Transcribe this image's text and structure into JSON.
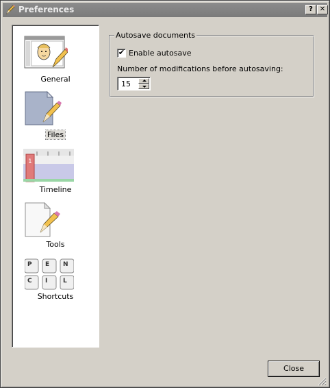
{
  "window": {
    "title": "Preferences",
    "help_button": "?",
    "close_button": "✕"
  },
  "sidebar": {
    "items": [
      {
        "label": "General",
        "icon": "general-icon"
      },
      {
        "label": "Files",
        "icon": "files-icon",
        "selected": true
      },
      {
        "label": "Timeline",
        "icon": "timeline-icon"
      },
      {
        "label": "Tools",
        "icon": "tools-icon"
      },
      {
        "label": "Shortcuts",
        "icon": "shortcuts-icon"
      }
    ]
  },
  "autosave": {
    "group_title": "Autosave documents",
    "enable_label": "Enable autosave",
    "enabled": true,
    "check_mark": "✔",
    "modifications_label": "Number of modifications before autosaving:",
    "modifications_value": "15"
  },
  "timeline_icon": {
    "frame_number": "1"
  },
  "shortcut_keys": [
    "P",
    "E",
    "N",
    "C",
    "I",
    "L"
  ],
  "footer": {
    "close_label": "Close"
  }
}
